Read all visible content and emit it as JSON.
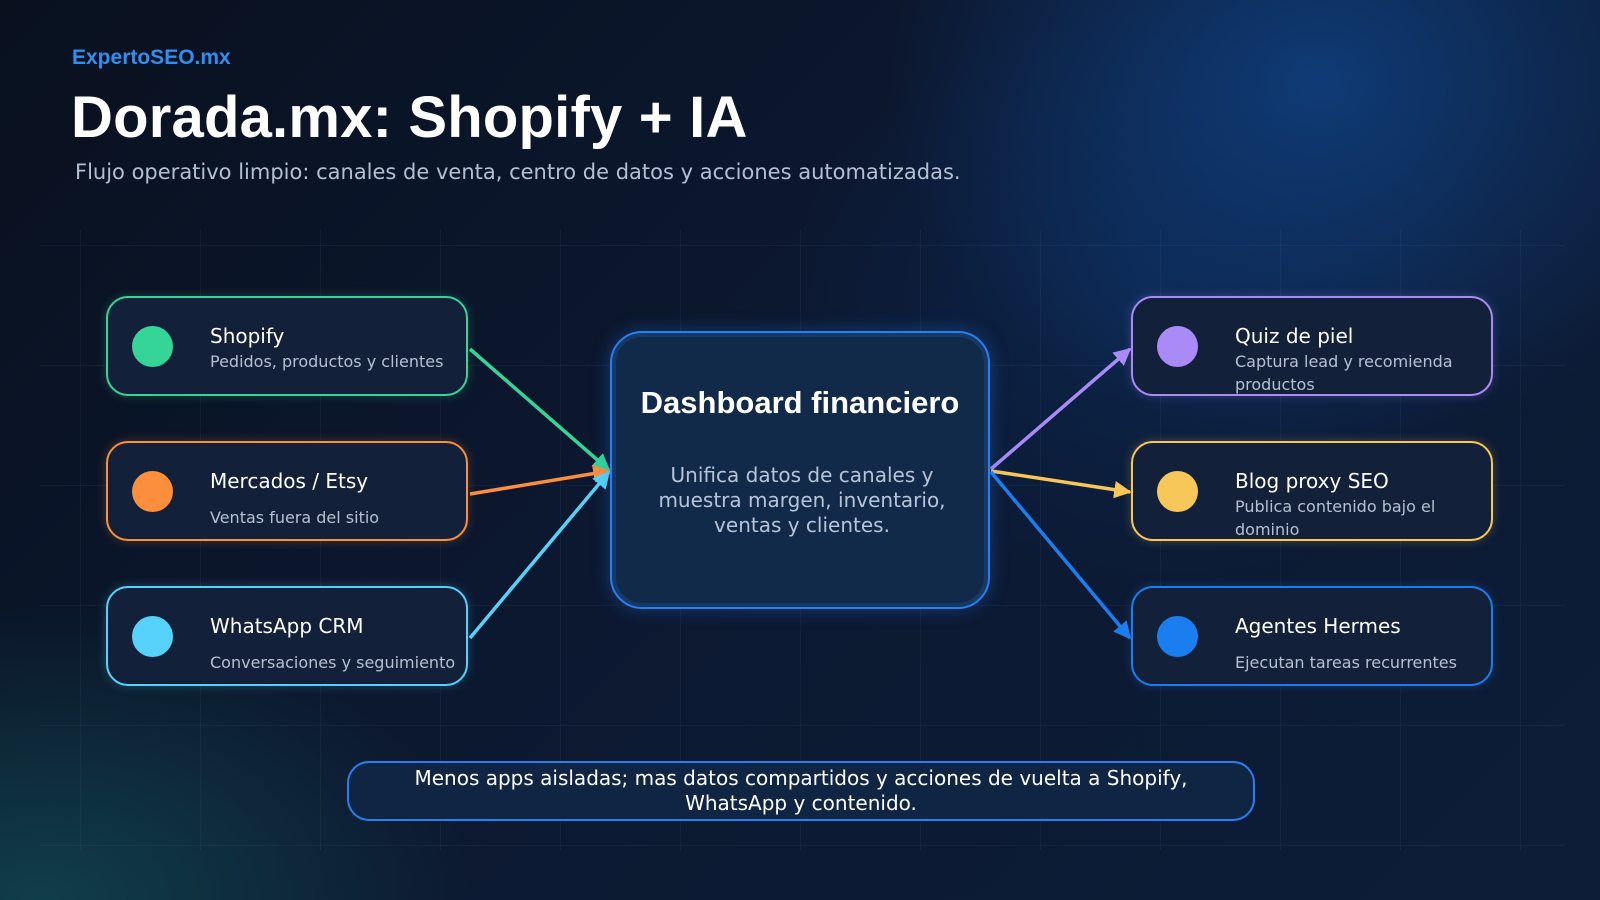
{
  "brand": "ExpertoSEO.mx",
  "title": "Dorada.mx: Shopify + IA",
  "subtitle": "Flujo operativo limpio: canales de venta, centro de datos y acciones automatizadas.",
  "hub": {
    "title": "Dashboard financiero",
    "description": "Unifica datos de canales y muestra margen, inventario, ventas y clientes."
  },
  "inputs": [
    {
      "name": "Shopify",
      "description": "Pedidos, productos y clientes",
      "color": "#35d497"
    },
    {
      "name": "Mercados / Etsy",
      "description": "Ventas fuera del sitio",
      "color": "#fb8f3b"
    },
    {
      "name": "WhatsApp CRM",
      "description": "Conversaciones y seguimiento",
      "color": "#56d2fa"
    }
  ],
  "outputs": [
    {
      "name": "Quiz de piel",
      "description": "Captura lead y recomienda productos",
      "color": "#a98af7"
    },
    {
      "name": "Blog proxy SEO",
      "description": "Publica contenido bajo el dominio",
      "color": "#f8c75a"
    },
    {
      "name": "Agentes Hermes",
      "description": "Ejecutan tareas recurrentes",
      "color": "#1b7ef0"
    }
  ],
  "footer": "Menos apps aisladas; mas datos compartidos y acciones de vuelta a Shopify, WhatsApp y contenido.",
  "colors": {
    "accent": "#2a7ff0",
    "brand": "#2f8ff0"
  }
}
